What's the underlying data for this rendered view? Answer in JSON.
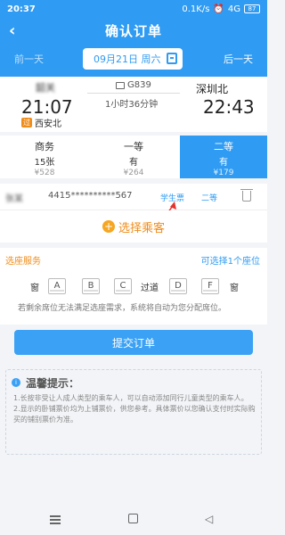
{
  "status": {
    "time": "20:37",
    "speed": "0.1K/s",
    "net": "4G",
    "battery": "87"
  },
  "header": {
    "title": "确认订单",
    "prev": "前一天",
    "next": "后一天",
    "date": "09月21日 周六"
  },
  "train": {
    "from_station": "韶关",
    "from_time": "21:07",
    "via_tag": "过",
    "via_station": "西安北",
    "number": "G839",
    "duration": "1小时36分钟",
    "to_station": "深圳北",
    "to_time": "22:43"
  },
  "seat_classes": [
    {
      "name": "商务",
      "count": "15张",
      "price": "¥528"
    },
    {
      "name": "一等",
      "count": "有",
      "price": "¥264"
    },
    {
      "name": "二等",
      "count": "有",
      "price": "¥179"
    }
  ],
  "passenger": {
    "name": "张某",
    "id": "4415**********567",
    "type": "学生票",
    "class": "二等"
  },
  "choose_passenger": "选择乘客",
  "seat_select": {
    "title": "选座服务",
    "hint": "可选择1个座位",
    "window": "窗",
    "aisle": "过道",
    "seats": [
      "A",
      "B",
      "C",
      "D",
      "F"
    ],
    "note": "若剩余席位无法满足选座需求，系统将自动为您分配席位。"
  },
  "submit_label": "提交订单",
  "tips": {
    "title": "温馨提示：",
    "text": "1.长按非受让人成人类型的乘车人，可以自动添加同行儿童类型的乘车人。\n2.显示的卧铺票价均为上铺票价，供您参考。具体票价以您确认支付时实际购买的铺别票价为准。"
  },
  "colors": {
    "primary": "#2f9bf2",
    "accent": "#f08c1a"
  }
}
